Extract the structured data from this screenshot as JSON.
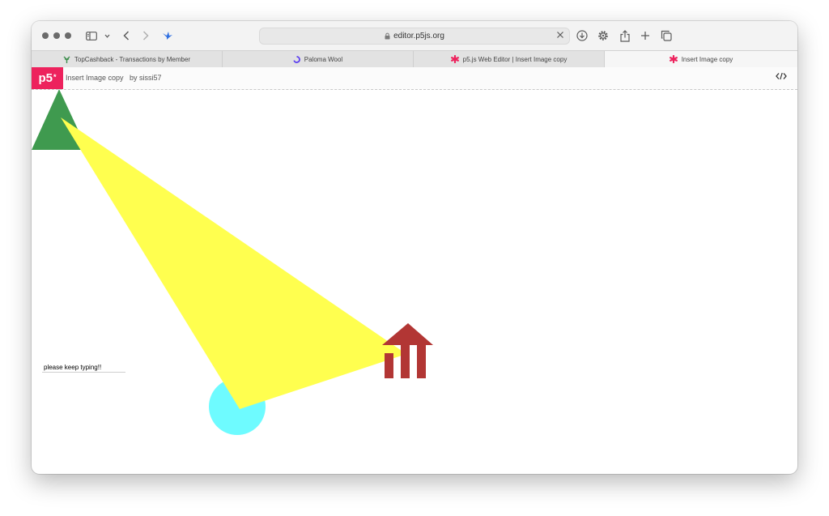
{
  "browser": {
    "address_url": "editor.p5js.org",
    "tabs": [
      {
        "label": "TopCashback - Transactions by Member",
        "icon": "topcashback-icon"
      },
      {
        "label": "Paloma Wool",
        "icon": "paloma-wool-icon"
      },
      {
        "label": "p5.js Web Editor | Insert Image copy",
        "icon": "p5-asterisk-icon"
      },
      {
        "label": "Insert Image copy",
        "icon": "p5-asterisk-icon",
        "active": true
      }
    ]
  },
  "p5_header": {
    "logo": "p5",
    "logo_mark": "*",
    "sketch_title": "Insert Image copy",
    "by": "by",
    "author": "sissi57"
  },
  "sketch": {
    "input_value": "please keep typing!!",
    "shapes": [
      {
        "name": "green-triangle",
        "color": "#3f9a4f"
      },
      {
        "name": "cyan-circle",
        "color": "#6efbff"
      },
      {
        "name": "yellow-triangle",
        "color": "#ffff4f"
      },
      {
        "name": "red-building",
        "color": "#b23634"
      }
    ]
  },
  "colors": {
    "p5_brand": "#ed225d",
    "p5_asterisk": "#ed225d"
  }
}
